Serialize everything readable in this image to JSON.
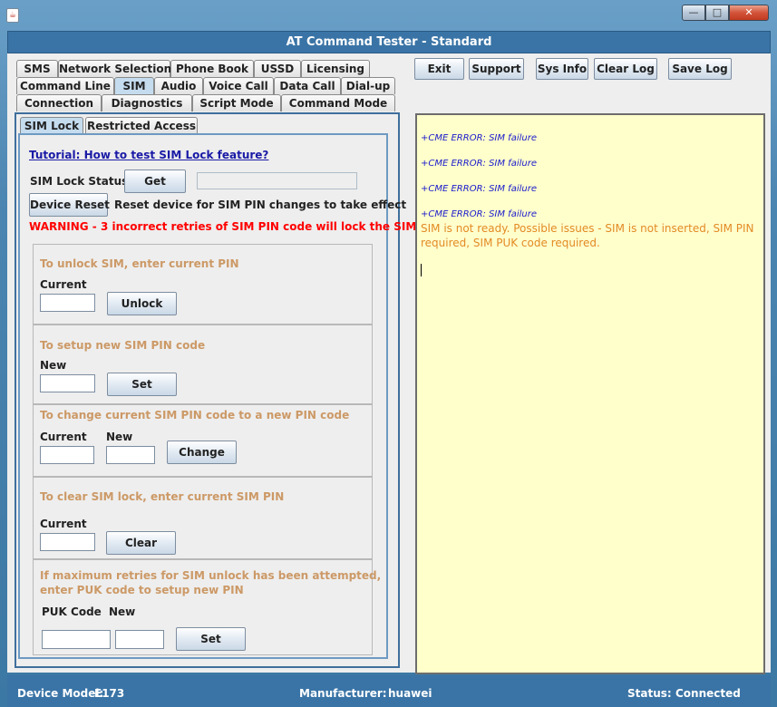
{
  "window": {
    "title": "AT Command Tester - Standard",
    "icon": "java-cup-icon",
    "controls": {
      "minimize": "—",
      "maximize": "□",
      "close": "✕"
    }
  },
  "tabs": {
    "row1": [
      "SMS",
      "Network Selection",
      "Phone Book",
      "USSD",
      "Licensing"
    ],
    "row2": [
      "Command Line",
      "SIM",
      "Audio",
      "Voice Call",
      "Data Call",
      "Dial-up"
    ],
    "row3": [
      "Connection",
      "Diagnostics",
      "Script Mode",
      "Command Mode"
    ],
    "selected": "SIM"
  },
  "subtabs": {
    "items": [
      "SIM Lock",
      "Restricted Access"
    ],
    "selected": "SIM Lock"
  },
  "toolbar": {
    "exit": "Exit",
    "support": "Support",
    "sysinfo": "Sys Info",
    "clearlog": "Clear Log",
    "savelog": "Save Log"
  },
  "simlock": {
    "tutorial_link": "Tutorial: How to test SIM Lock feature?",
    "status_label": "SIM Lock Status",
    "get_button": "Get",
    "status_value": "",
    "device_reset_button": "Device Reset",
    "reset_note": "Reset device for SIM PIN changes to take effect",
    "warning": "WARNING - 3 incorrect retries of SIM PIN code will lock the SIM",
    "unlock": {
      "title": "To unlock SIM, enter current PIN",
      "current_label": "Current",
      "button": "Unlock"
    },
    "setup": {
      "title": "To setup new SIM PIN code",
      "new_label": "New",
      "button": "Set"
    },
    "change": {
      "title": "To change current SIM PIN code to a new PIN code",
      "current_label": "Current",
      "new_label": "New",
      "button": "Change"
    },
    "clear": {
      "title": "To clear SIM lock, enter current SIM PIN",
      "current_label": "Current",
      "button": "Clear"
    },
    "puk": {
      "title_line1": "If maximum retries for SIM unlock has been attempted,",
      "title_line2": "enter PUK code to setup new PIN",
      "puk_label": "PUK Code",
      "new_label": "New",
      "button": "Set"
    }
  },
  "log": {
    "errors": [
      "+CME ERROR: SIM failure",
      "+CME ERROR: SIM failure",
      "+CME ERROR: SIM failure",
      "+CME ERROR: SIM failure"
    ],
    "message_line1": "SIM is not ready. Possible issues - SIM is not inserted, SIM PIN",
    "message_line2": "required, SIM PUK code required."
  },
  "status": {
    "model_label": "Device Model:",
    "model_value": "E173",
    "manufacturer_label": "Manufacturer:",
    "manufacturer_value": "huawei",
    "status_label": "Status:",
    "status_value": "Connected"
  },
  "colors": {
    "accent": "#3a74a6",
    "warning": "#ff0000",
    "section_title": "#cc9966",
    "log_background": "#ffffcc",
    "log_error": "#1a1acc",
    "log_message": "#e38a25"
  }
}
